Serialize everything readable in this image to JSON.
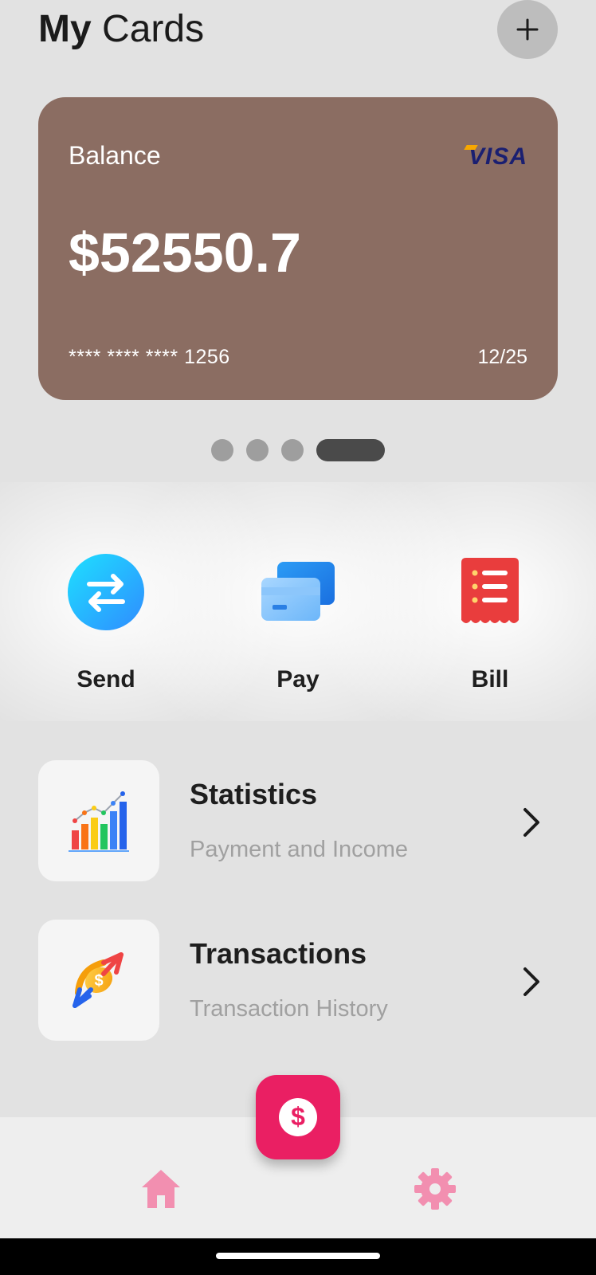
{
  "header": {
    "title_bold": "My",
    "title_rest": "Cards",
    "add_icon": "plus-icon"
  },
  "card": {
    "label": "Balance",
    "brand": "VISA",
    "balance": "$52550.7",
    "number": "**** **** **** 1256",
    "expiry": "12/25",
    "color": "#8b6d62"
  },
  "carousel": {
    "count": 4,
    "active_index": 3
  },
  "quick_actions": [
    {
      "label": "Send",
      "icon": "transfer-icon"
    },
    {
      "label": "Pay",
      "icon": "credit-card-icon"
    },
    {
      "label": "Bill",
      "icon": "receipt-icon"
    }
  ],
  "menu": [
    {
      "title": "Statistics",
      "subtitle": "Payment and Income",
      "icon": "bar-chart-icon"
    },
    {
      "title": "Transactions",
      "subtitle": "Transaction History",
      "icon": "money-exchange-icon"
    }
  ],
  "bottom_nav": {
    "home_icon": "home-icon",
    "settings_icon": "gear-icon",
    "fab_icon": "dollar-icon",
    "accent": "#ea1f63",
    "nav_color": "#f28fb0"
  }
}
